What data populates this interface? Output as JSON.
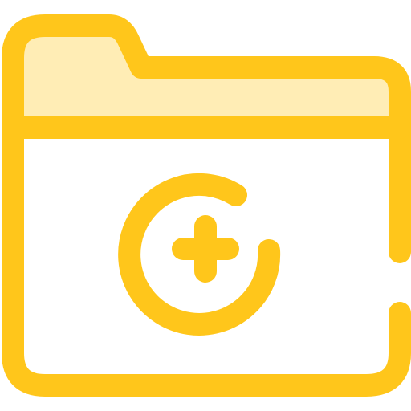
{
  "icon": {
    "name": "folder-add-icon",
    "stroke_color": "#FFC61B",
    "tab_fill_color": "#FFEDB5",
    "background_color": "#FFFFFF"
  }
}
